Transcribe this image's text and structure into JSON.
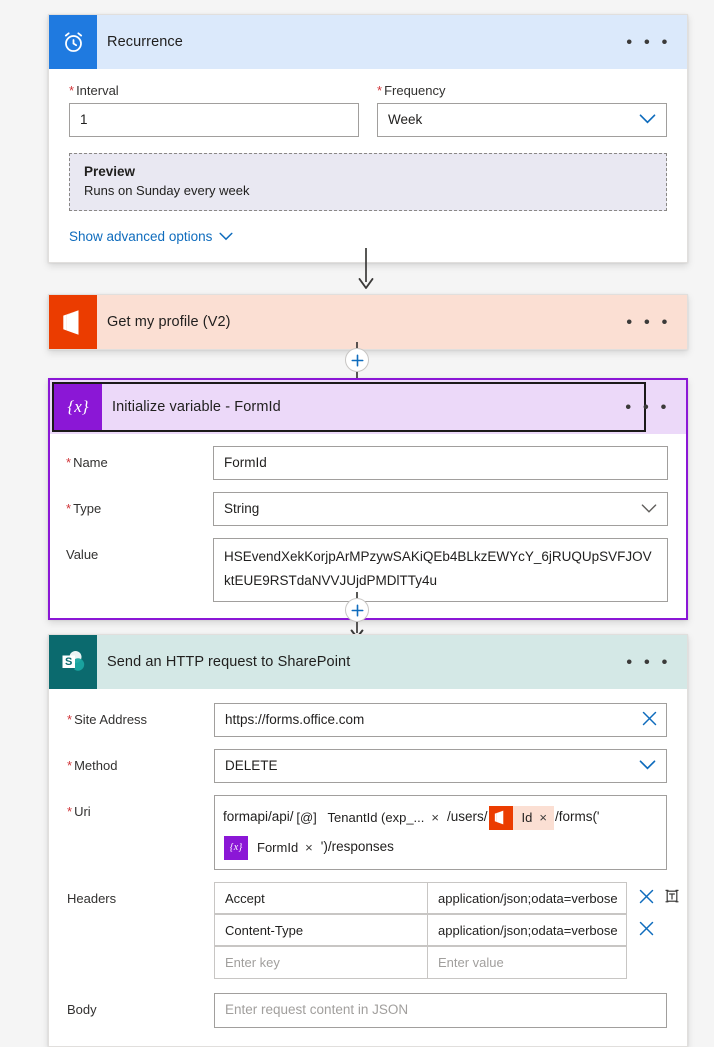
{
  "flow": {
    "recurrence": {
      "title": "Recurrence",
      "icon": "alarm-clock-icon",
      "accent": "#1f7ae0",
      "header_bg": "#dbe9fb",
      "interval_label": "Interval",
      "interval_value": "1",
      "frequency_label": "Frequency",
      "frequency_value": "Week",
      "preview_title": "Preview",
      "preview_text": "Runs on Sunday every week",
      "advanced_label": "Show advanced options",
      "menu": "• • •"
    },
    "get_profile": {
      "title": "Get my profile (V2)",
      "icon": "office-365-icon",
      "accent": "#eb3c00",
      "header_bg": "#fbdfd3",
      "menu": "• • •"
    },
    "init_variable": {
      "title": "Initialize variable - FormId",
      "icon": "variable-braces-icon",
      "icon_glyph": "{x}",
      "accent": "#8b17d6",
      "header_bg": "#ecd9f9",
      "selected": true,
      "menu": "• • •",
      "fields": [
        {
          "label": "Name",
          "required": true,
          "value": "FormId",
          "type": "text"
        },
        {
          "label": "Type",
          "required": true,
          "value": "String",
          "type": "select"
        }
      ],
      "value_label": "Value",
      "value_text": "HSEvendXekKorjpArMPzywSAKiQEb4BLkzEWYcY_6jRUQUpSVFJOVktEUE9RSTdaNVVJUjdPMDlTTy4u"
    },
    "sharepoint": {
      "title": "Send an HTTP request to SharePoint",
      "icon": "sharepoint-icon",
      "accent": "#0b6a6e",
      "header_bg": "#d4e8e6",
      "menu": "• • •",
      "site_address_label": "Site Address",
      "site_address_value": "https://forms.office.com",
      "method_label": "Method",
      "method_value": "DELETE",
      "uri_label": "Uri",
      "uri_parts": [
        {
          "kind": "text",
          "text": "formapi/api/"
        },
        {
          "kind": "token",
          "icon": "expression-icon",
          "icon_glyph": "[@]",
          "label": "TenantId (exp_...",
          "style": "expression"
        },
        {
          "kind": "text",
          "text": "/users/"
        },
        {
          "kind": "token",
          "icon": "office-365-icon",
          "label": "Id",
          "style": "office"
        },
        {
          "kind": "text",
          "text": "/forms('"
        },
        {
          "kind": "token",
          "icon": "variable-braces-icon",
          "icon_glyph": "{x}",
          "label": "FormId",
          "style": "variable"
        },
        {
          "kind": "text",
          "text": "')/responses"
        }
      ],
      "headers_label": "Headers",
      "headers": [
        {
          "key": "Accept",
          "value": "application/json;odata=verbose",
          "placeholder": false
        },
        {
          "key": "Content-Type",
          "value": "application/json;odata=verbose",
          "placeholder": false
        },
        {
          "key": "Enter key",
          "value": "Enter value",
          "placeholder": true
        }
      ],
      "body_label": "Body",
      "body_placeholder": "Enter request content in JSON"
    },
    "connectors": {
      "add_step_glyph": "+",
      "add_step_name": "insert-new-step-button"
    }
  }
}
